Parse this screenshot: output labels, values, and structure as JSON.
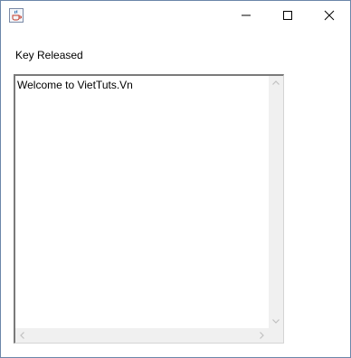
{
  "window": {
    "icon": "java-cup-icon",
    "controls": [
      "minimize-icon",
      "maximize-icon",
      "close-icon"
    ]
  },
  "status_label": "Key Released",
  "textarea": {
    "value": "Welcome to VietTuts.Vn"
  },
  "colors": {
    "border": "#6b86a9",
    "scrollbar_track": "#f0f0f0",
    "scrollbar_arrow": "#c0c0c0"
  }
}
